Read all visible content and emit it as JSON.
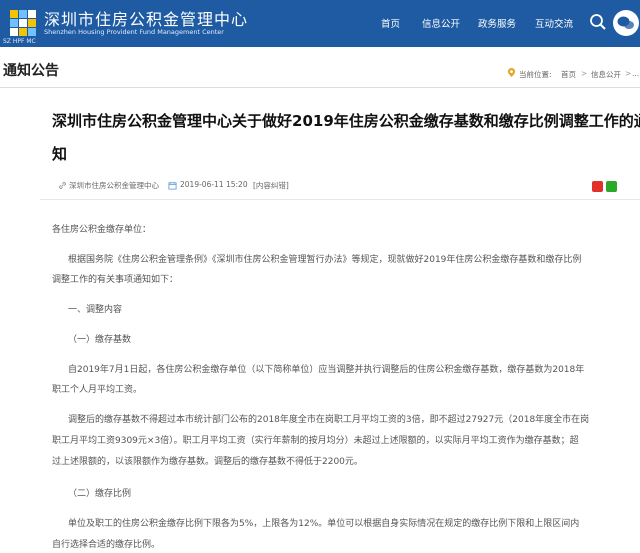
{
  "header": {
    "site_name_cn": "深圳市住房公积金管理中心",
    "site_name_en": "Shenzhen Housing Provident Fund Management Center",
    "logo_abbr": "SZ HPF MC",
    "nav": [
      {
        "label": "首页"
      },
      {
        "label": "信息公开"
      },
      {
        "label": "政务服务"
      },
      {
        "label": "互动交流"
      }
    ],
    "brand_color": "#1e5ba3"
  },
  "section": {
    "title": "通知公告",
    "breadcrumb_prefix": "当前位置:",
    "breadcrumb": [
      "首页",
      "信息公开",
      "..."
    ],
    "separator": ">"
  },
  "article": {
    "title_line1": "深圳市住房公积金管理中心关于做好2019年住房公积金缴存基数和缴存比例调整工作的通",
    "title_line2": "知",
    "meta": {
      "source": "深圳市住房公积金管理中心",
      "date": "2019-06-11 15:20",
      "error_correction": "[内容纠错]"
    },
    "paragraphs": [
      "各住房公积金缴存单位：",
      "根据国务院《住房公积金管理条例》《深圳市住房公积金管理暂行办法》等规定，现就做好2019年住房公积金缴存基数和缴存比例",
      "调整工作的有关事项通知如下：",
      "一、调整内容",
      "（一）缴存基数",
      "自2019年7月1日起，各住房公积金缴存单位（以下简称单位）应当调整并执行调整后的住房公积金缴存基数，缴存基数为2018年",
      "职工个人月平均工资。",
      "调整后的缴存基数不得超过本市统计部门公布的2018年度全市在岗职工月平均工资的3倍，即不超过27927元（2018年度全市在岗",
      "职工月平均工资9309元×3倍）。职工月平均工资（实行年薪制的按月均分）未超过上述限额的，以实际月平均工资作为缴存基数；超",
      "过上述限额的，以该限额作为缴存基数。调整后的缴存基数不得低于2200元。",
      "（二）缴存比例",
      "单位及职工的住房公积金缴存比例下限各为5%，上限各为12%。单位可以根据自身实际情况在规定的缴存比例下限和上限区间内",
      "自行选择合适的缴存比例。"
    ]
  }
}
